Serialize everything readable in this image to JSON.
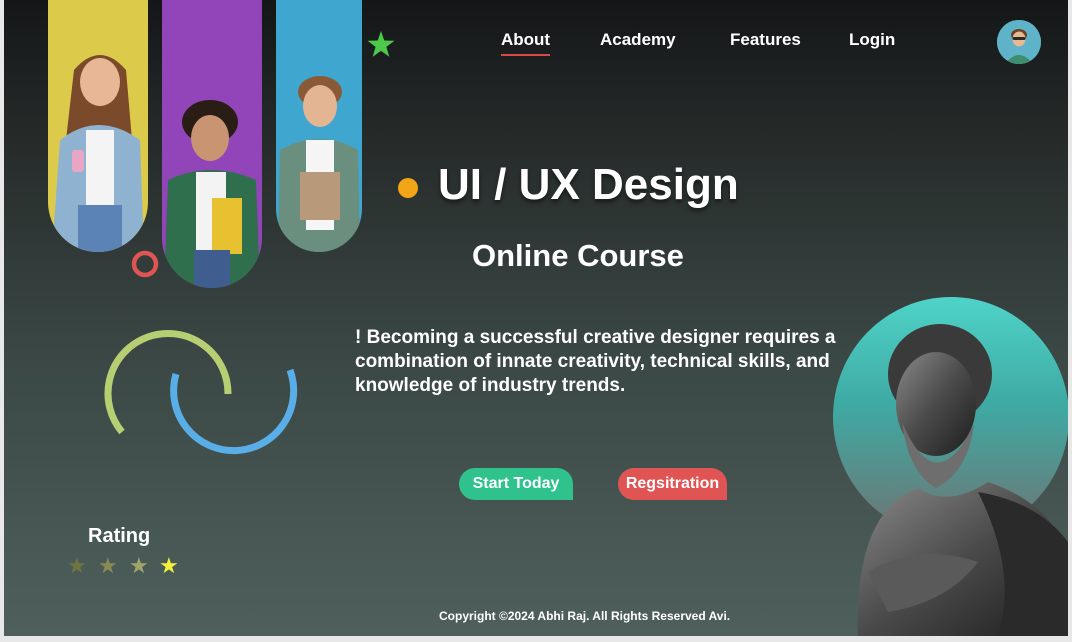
{
  "nav": {
    "items": [
      {
        "label": "About",
        "active": true
      },
      {
        "label": "Academy",
        "active": false
      },
      {
        "label": "Features",
        "active": false
      },
      {
        "label": "Login",
        "active": false
      }
    ]
  },
  "hero": {
    "title": "UI / UX Design",
    "subtitle": "Online Course",
    "description": "! Becoming a successful creative designer requires a combination of innate creativity, technical skills, and knowledge of industry trends."
  },
  "buttons": {
    "start_label": "Start Today",
    "register_label": "Regsitration"
  },
  "rating": {
    "label": "Rating",
    "stars_total": 4,
    "highlighted": 1
  },
  "footer": {
    "text": "Copyright ©2024 Abhi Raj. All Rights Reserved  Avi."
  },
  "colors": {
    "accent_green": "#2fc28c",
    "accent_red": "#e15454",
    "dot_orange": "#f2a516",
    "star_green": "#4cc94a",
    "ring_lime": "#b7cf73",
    "ring_blue": "#5aaee8",
    "strip_yellow": "#dccb4a",
    "strip_purple": "#9145b8",
    "strip_blue": "#3fa6cf"
  },
  "icons": {
    "deco_star": "star-icon",
    "deco_ring": "ring-icon",
    "avatar": "avatar-icon"
  }
}
